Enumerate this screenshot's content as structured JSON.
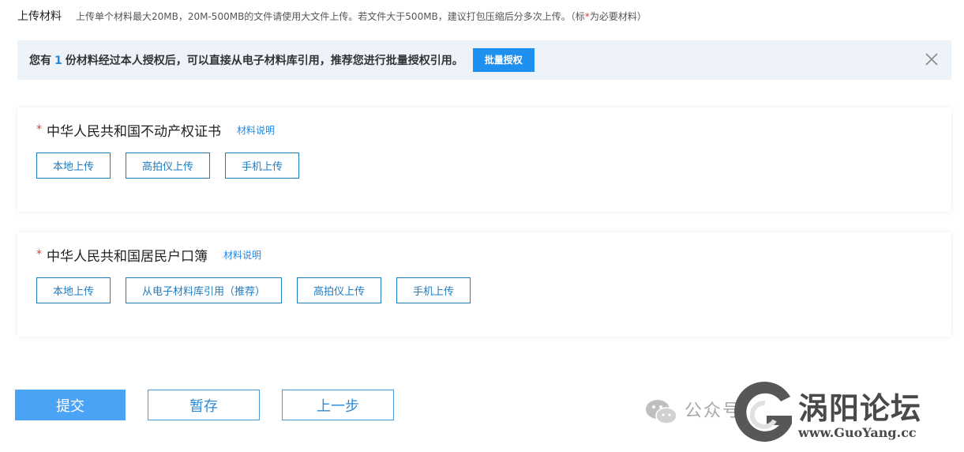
{
  "header": {
    "title": "上传材料",
    "hint_main": "上传单个材料最大20MB，20M-500MB的文件请使用大文件上传。若文件大于500MB，建议打包压缩后分多次上传。",
    "hint_open": "（标",
    "hint_star": "*",
    "hint_close": "为必要材料）"
  },
  "notice": {
    "text_before": "您有",
    "count": "1",
    "text_after": "份材料经过本人授权后，可以直接从电子材料库引用，推荐您进行批量授权引用。",
    "batch_label": "批量授权",
    "close_icon": "close-icon"
  },
  "materials": [
    {
      "required": "*",
      "name": "中华人民共和国不动产权证书",
      "explain": "材料说明",
      "buttons": [
        "本地上传",
        "高拍仪上传",
        "手机上传"
      ]
    },
    {
      "required": "*",
      "name": "中华人民共和国居民户口簿",
      "explain": "材料说明",
      "buttons": [
        "本地上传",
        "从电子材料库引用（推荐）",
        "高拍仪上传",
        "手机上传"
      ]
    }
  ],
  "footer": {
    "submit_label": "提交",
    "save_label": "暂存",
    "prev_label": "上一步"
  },
  "watermark": {
    "account_label": "公众号",
    "site_name": "涡阳论坛",
    "site_url": "www.GuoYang.cc",
    "icons": [
      "wechat-icon",
      "logo-g-icon"
    ]
  },
  "colors": {
    "accent": "#1e90f0",
    "required": "#e53935",
    "notice_bg": "#eef3fa",
    "submit_bg": "#4ba3f5"
  }
}
